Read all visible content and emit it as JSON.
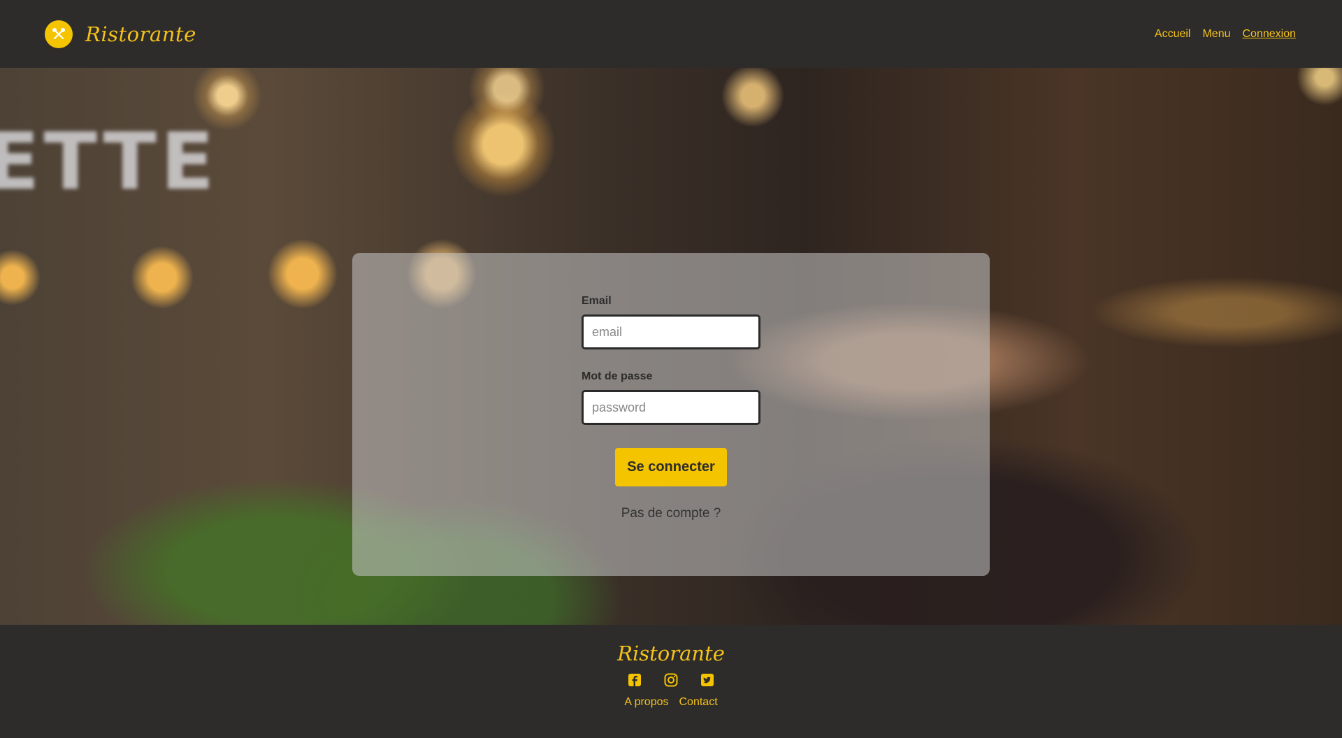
{
  "colors": {
    "accent": "#f5c400",
    "dark": "#2d2c2b"
  },
  "header": {
    "brand": "Ristorante",
    "logo_icon": "fork-knife-icon",
    "nav": [
      {
        "label": "Accueil"
      },
      {
        "label": "Menu"
      },
      {
        "label": "Connexion",
        "active": true
      }
    ]
  },
  "hero": {
    "neon_sign": "ETTE"
  },
  "login": {
    "email_label": "Email",
    "email_placeholder": "email",
    "email_value": "",
    "password_label": "Mot de passe",
    "password_placeholder": "password",
    "password_value": "",
    "submit_label": "Se connecter",
    "signup_link": "Pas de compte ?"
  },
  "footer": {
    "brand": "Ristorante",
    "socials": [
      "facebook-icon",
      "instagram-icon",
      "twitter-icon"
    ],
    "links": [
      {
        "label": "A propos"
      },
      {
        "label": "Contact"
      }
    ]
  }
}
